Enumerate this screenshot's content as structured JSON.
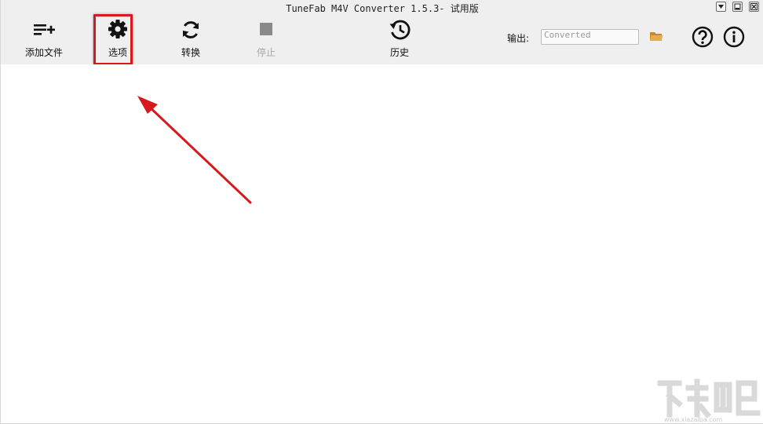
{
  "window": {
    "title": "TuneFab M4V Converter 1.5.3- 试用版"
  },
  "toolbar": {
    "add_files_label": "添加文件",
    "options_label": "选项",
    "convert_label": "转换",
    "stop_label": "停止",
    "history_label": "历史"
  },
  "output": {
    "label": "输出:",
    "value": "Converted"
  },
  "colors": {
    "highlight": "#d7191d",
    "folder": "#e0a23a",
    "disabled_text": "#a8a8a8"
  },
  "icons": {
    "add_files": "playlist-add-icon",
    "options": "gear-icon",
    "convert": "refresh-icon",
    "stop": "stop-icon",
    "history": "history-icon",
    "folder": "folder-icon",
    "help": "help-circle-icon",
    "info": "info-circle-icon"
  },
  "watermark": {
    "text": "www.xiazaiba.com"
  }
}
